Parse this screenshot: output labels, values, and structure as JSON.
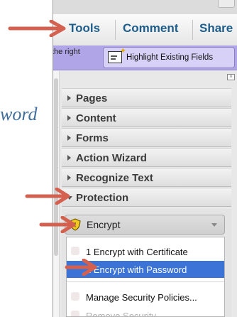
{
  "background_text": "word",
  "tabs": [
    {
      "label": "Tools"
    },
    {
      "label": "Comment"
    },
    {
      "label": "Share"
    }
  ],
  "toolbar": {
    "hint_text": "the right",
    "highlight_button_label": "Highlight Existing Fields"
  },
  "panel": {
    "sections": [
      {
        "label": "Pages",
        "expanded": false
      },
      {
        "label": "Content",
        "expanded": false
      },
      {
        "label": "Forms",
        "expanded": false
      },
      {
        "label": "Action Wizard",
        "expanded": false
      },
      {
        "label": "Recognize Text",
        "expanded": false
      },
      {
        "label": "Protection",
        "expanded": true
      }
    ],
    "encrypt": {
      "label": "Encrypt"
    },
    "menu": {
      "items": [
        {
          "label": "1 Encrypt with Certificate",
          "selected": false
        },
        {
          "label": "2 Encrypt with Password",
          "selected": true
        },
        {
          "label": "Manage Security Policies...",
          "selected": false
        },
        {
          "label": "Remove Security",
          "selected": false
        }
      ]
    }
  },
  "colors": {
    "tab_text": "#1d5e8c",
    "toolbar_bg": "#b0a5e6",
    "menu_selection": "#3b74d6",
    "annotation_arrow": "#d4604f"
  }
}
